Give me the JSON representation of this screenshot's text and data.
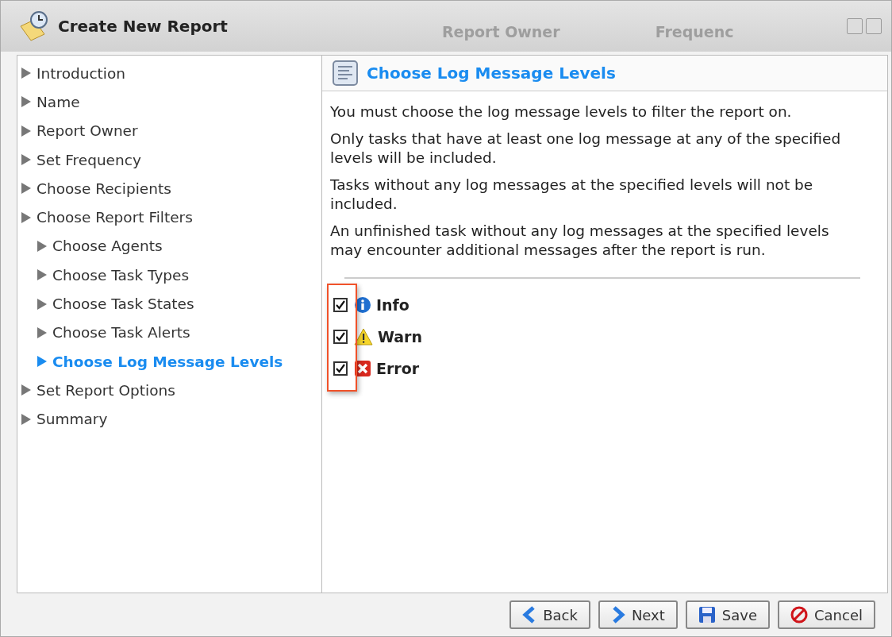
{
  "window": {
    "title": "Create New Report",
    "background_tabs": [
      "Report Owner",
      "Frequenc"
    ]
  },
  "nav": {
    "items": [
      {
        "label": "Introduction",
        "selected": false
      },
      {
        "label": "Name",
        "selected": false
      },
      {
        "label": "Report Owner",
        "selected": false
      },
      {
        "label": "Set Frequency",
        "selected": false
      },
      {
        "label": "Choose Recipients",
        "selected": false
      },
      {
        "label": "Choose Report Filters",
        "selected": false,
        "children": [
          {
            "label": "Choose Agents",
            "selected": false
          },
          {
            "label": "Choose Task Types",
            "selected": false
          },
          {
            "label": "Choose Task States",
            "selected": false
          },
          {
            "label": "Choose Task Alerts",
            "selected": false
          },
          {
            "label": "Choose Log Message Levels",
            "selected": true
          }
        ]
      },
      {
        "label": "Set Report Options",
        "selected": false
      },
      {
        "label": "Summary",
        "selected": false
      }
    ]
  },
  "panel": {
    "title": "Choose Log Message Levels",
    "paragraphs": [
      "You must choose the log message levels to filter the report on.",
      "Only tasks that have at least one log message at any of the specified levels will be included.",
      "Tasks without any log messages at the specified levels will not be included.",
      "An unfinished task without any log messages at the specified levels may encounter additional messages after the report is run."
    ],
    "levels": [
      {
        "label": "Info",
        "kind": "info",
        "checked": true
      },
      {
        "label": "Warn",
        "kind": "warn",
        "checked": true
      },
      {
        "label": "Error",
        "kind": "error",
        "checked": true
      }
    ]
  },
  "buttons": [
    {
      "label": "Back",
      "kind": "back"
    },
    {
      "label": "Next",
      "kind": "next"
    },
    {
      "label": "Save",
      "kind": "save"
    },
    {
      "label": "Cancel",
      "kind": "cancel"
    }
  ]
}
